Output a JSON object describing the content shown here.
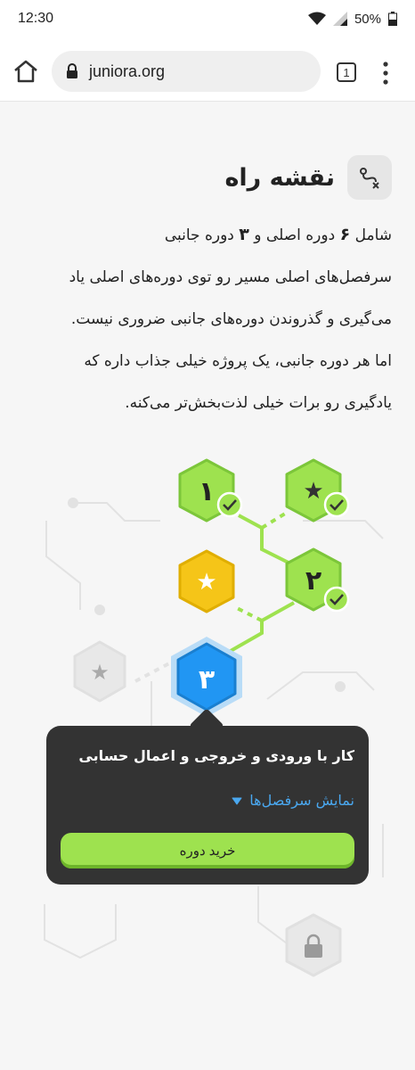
{
  "status_bar": {
    "time": "12:30",
    "battery": "50%"
  },
  "browser": {
    "url": "juniora.org",
    "tab_count": "1"
  },
  "roadmap": {
    "title": "نقشه راه",
    "description": {
      "prefix": "شامل",
      "main_count": "۶",
      "middle": "دوره اصلی و",
      "side_count": "۳",
      "suffix": "دوره جانبی",
      "lines": [
        "سرفصل‌های اصلی مسیر رو توی دوره‌های اصلی یاد",
        "می‌گیری و گذروندن دوره‌های جانبی ضروری نیست.",
        "اما هر دوره جانبی، یک پروژه خیلی جذاب داره که",
        "یادگیری رو برات خیلی لذت‌بخش‌تر می‌کنه."
      ]
    },
    "nodes": [
      {
        "label": "۱",
        "kind": "main",
        "color": "#9ee24f",
        "done": true
      },
      {
        "label": "★",
        "kind": "side",
        "color": "#9ee24f",
        "done": true
      },
      {
        "label": "۲",
        "kind": "main",
        "color": "#9ee24f",
        "done": true
      },
      {
        "label": "★",
        "kind": "side",
        "color": "#f5c518",
        "done": false
      },
      {
        "label": "۳",
        "kind": "main",
        "color": "#2196f3",
        "done": false
      },
      {
        "label": "★",
        "kind": "side",
        "color": "#e8e8e8",
        "done": false
      }
    ]
  },
  "popup": {
    "title": "کار با ورودی و خروجی و اعمال حسابی",
    "show_chapters": "نمایش سرفصل‌ها",
    "buy_button": "خرید دوره"
  },
  "colors": {
    "green": "#9ee24f",
    "yellow": "#f5c518",
    "blue": "#2196f3",
    "popup_bg": "#333333",
    "link": "#4aa8f0"
  }
}
